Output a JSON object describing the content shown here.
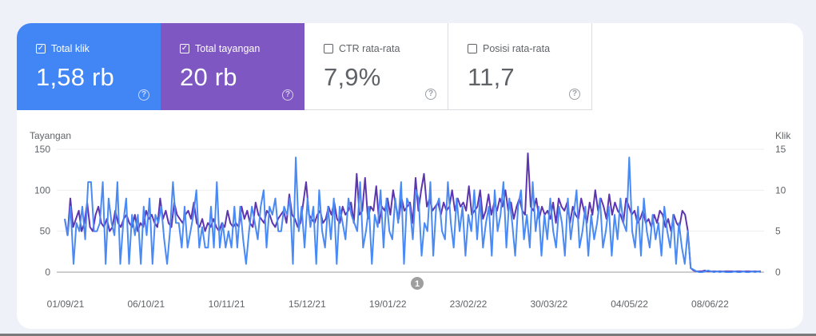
{
  "metrics": [
    {
      "label": "Total klik",
      "value": "1,58 rb",
      "checked": true,
      "color": "#4285f4"
    },
    {
      "label": "Total tayangan",
      "value": "20 rb",
      "checked": true,
      "color": "#7e57c2"
    },
    {
      "label": "CTR rata-rata",
      "value": "7,9%",
      "checked": false
    },
    {
      "label": "Posisi rata-rata",
      "value": "11,7",
      "checked": false
    }
  ],
  "help_glyph": "?",
  "check_glyph": "✓",
  "annotation_marker": "1",
  "chart_data": {
    "type": "line",
    "left_axis": {
      "label": "Tayangan",
      "ticks": [
        "150",
        "100",
        "50",
        "0"
      ],
      "range": [
        0,
        150
      ]
    },
    "right_axis": {
      "label": "Klik",
      "ticks": [
        "15",
        "10",
        "5",
        "0"
      ],
      "range": [
        0,
        15
      ]
    },
    "x_tick_labels": [
      "01/09/21",
      "06/10/21",
      "10/11/21",
      "15/12/21",
      "19/01/22",
      "23/02/22",
      "30/03/22",
      "04/05/22",
      "08/06/22"
    ],
    "grid": true,
    "series": [
      {
        "name": "Total tayangan",
        "axis": "left",
        "color": "#5e35b1",
        "values": [
          65,
          45,
          90,
          55,
          65,
          75,
          50,
          60,
          85,
          55,
          50,
          70,
          80,
          60,
          55,
          65,
          50,
          55,
          75,
          60,
          55,
          65,
          70,
          60,
          55,
          70,
          50,
          60,
          55,
          75,
          65,
          70,
          60,
          55,
          90,
          65,
          75,
          60,
          55,
          85,
          70,
          65,
          60,
          70,
          75,
          65,
          85,
          60,
          55,
          65,
          50,
          60,
          55,
          65,
          55,
          50,
          60,
          55,
          75,
          60,
          55,
          60,
          55,
          80,
          65,
          75,
          60,
          55,
          85,
          70,
          65,
          60,
          75,
          70,
          60,
          55,
          65,
          70,
          75,
          60,
          95,
          70,
          65,
          55,
          60,
          85,
          110,
          70,
          65,
          60,
          70,
          75,
          60,
          65,
          80,
          70,
          85,
          65,
          60,
          80,
          70,
          75,
          85,
          60,
          120,
          70,
          75,
          115,
          65,
          80,
          75,
          105,
          60,
          80,
          75,
          90,
          70,
          100,
          80,
          65,
          90,
          75,
          80,
          85,
          60,
          115,
          75,
          100,
          120,
          80,
          90,
          75,
          80,
          85,
          70,
          85,
          75,
          80,
          100,
          75,
          90,
          80,
          85,
          75,
          105,
          70,
          75,
          80,
          100,
          65,
          75,
          95,
          70,
          85,
          75,
          90,
          80,
          100,
          75,
          85,
          65,
          80,
          90,
          75,
          70,
          145,
          80,
          75,
          90,
          65,
          80,
          70,
          75,
          65,
          85,
          60,
          90,
          80,
          75,
          85,
          60,
          80,
          70,
          65,
          90,
          75,
          60,
          85,
          70,
          100,
          75,
          90,
          80,
          65,
          95,
          70,
          85,
          75,
          70,
          60,
          90,
          80,
          70,
          75,
          60,
          65,
          75,
          60,
          65,
          55,
          70,
          60,
          75,
          70,
          55,
          65,
          50,
          70,
          60,
          55,
          75,
          70,
          50,
          5,
          2,
          1,
          1,
          1,
          2,
          1,
          1,
          1,
          1,
          1,
          1,
          1,
          1,
          1,
          1,
          1,
          1,
          1,
          1,
          1,
          1,
          1,
          1,
          1,
          1
        ]
      },
      {
        "name": "Total klik",
        "axis": "right",
        "color": "#4a8af4",
        "values": [
          6.5,
          4.5,
          8,
          1,
          6,
          5,
          8,
          4,
          11,
          11,
          5,
          5,
          6,
          11,
          1,
          9,
          6,
          4.5,
          11,
          1,
          6,
          9,
          1,
          7,
          4.5,
          7,
          1,
          8,
          4.5,
          9,
          1,
          7,
          6,
          8,
          4,
          1,
          5,
          11,
          6,
          6,
          3,
          8,
          3,
          5,
          7,
          10,
          3,
          5.5,
          3,
          3,
          8,
          3,
          11,
          3,
          6,
          3,
          5,
          3,
          8,
          3,
          8,
          4,
          1,
          5,
          8,
          6,
          4,
          8,
          10,
          3,
          8,
          7,
          9,
          5,
          5,
          8,
          7,
          9,
          1,
          14,
          5,
          8,
          3,
          9,
          5.5,
          8,
          1,
          10,
          5,
          3,
          8,
          4,
          9,
          1,
          8,
          6,
          4,
          9,
          7,
          6,
          5,
          11,
          3,
          5,
          8,
          1,
          7,
          5.5,
          10,
          3,
          9,
          5,
          4,
          9,
          6,
          11,
          1,
          9,
          8,
          4,
          10,
          9,
          2,
          6,
          5,
          11,
          2,
          8,
          9,
          5,
          4,
          11,
          6,
          3,
          9,
          5,
          8,
          2,
          7,
          5,
          10,
          4,
          9,
          3,
          6,
          8,
          2,
          10,
          5,
          7,
          11,
          3,
          9,
          6,
          2,
          8,
          10,
          4,
          7,
          3,
          11,
          5,
          8,
          2,
          7,
          4,
          9,
          5,
          3,
          8,
          6,
          2,
          9,
          4,
          7,
          10,
          3,
          5,
          8,
          2,
          7,
          4,
          6,
          9,
          3,
          5,
          8,
          2,
          7,
          4,
          9,
          6,
          5,
          14,
          5,
          3,
          8,
          2,
          9,
          5,
          3,
          7,
          4,
          6,
          2,
          8,
          5,
          3,
          7,
          1,
          6,
          3,
          1,
          5,
          0.5,
          0.3,
          0.1,
          0,
          0,
          0.1,
          0.2,
          0.1,
          0,
          0.1,
          0,
          0.1,
          0,
          0,
          0,
          0.1,
          0,
          0,
          0.1,
          0,
          0,
          0.1,
          0,
          0.1,
          0
        ]
      }
    ]
  }
}
